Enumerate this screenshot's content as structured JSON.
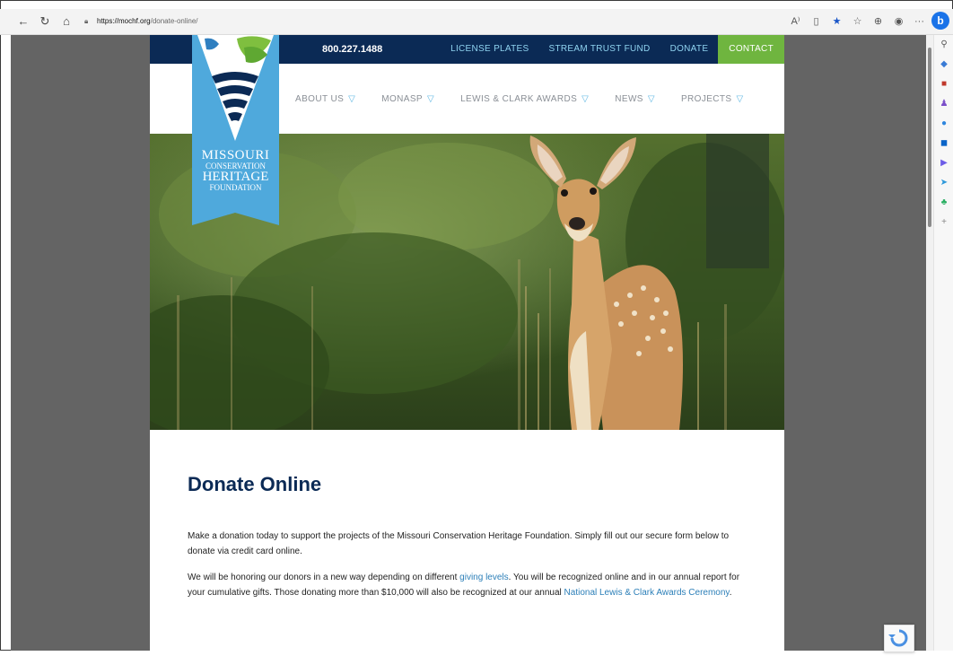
{
  "browser": {
    "url_host": "https://mochf.org",
    "url_path": "/donate-online/",
    "nav_icons": [
      "back-arrow",
      "refresh",
      "home"
    ],
    "toolbar_icons": [
      "read-aloud",
      "immersive-reader",
      "favorite-star",
      "favorites",
      "collections",
      "profile",
      "more"
    ]
  },
  "sidebar_icons": [
    "search",
    "shopping-tag",
    "tools-briefcase",
    "games",
    "office",
    "outlook",
    "drop",
    "send",
    "tree",
    "add"
  ],
  "site": {
    "colors": {
      "navy": "#0b2a55",
      "accent_blue": "#5fb7e3",
      "green": "#6fb53f",
      "link": "#2c7fb8"
    },
    "topbar": {
      "phone": "800.227.1488",
      "links": [
        "LICENSE PLATES",
        "STREAM TRUST FUND",
        "DONATE"
      ],
      "contact": "CONTACT"
    },
    "nav": [
      "ABOUT US",
      "MONASP",
      "LEWIS & CLARK AWARDS",
      "NEWS",
      "PROJECTS"
    ],
    "logo": {
      "line1": "MISSOURI",
      "line2": "CONSERVATION",
      "line3": "HERITAGE",
      "line4": "FOUNDATION"
    },
    "hero_image": "white-tailed-fawn-in-brush",
    "page": {
      "title": "Donate Online",
      "p1": "Make a donation today to support the projects of the Missouri Conservation Heritage Foundation. Simply fill out our secure form below to donate via credit card online.",
      "p2_a": "We will be honoring our donors in a new way depending on different ",
      "p2_link1": "giving levels",
      "p2_b": ". You will be recognized online and in our annual report for your cumulative gifts. Those donating more than $10,000 will also be recognized at our annual ",
      "p2_link2": "National Lewis & Clark Awards Ceremony",
      "p2_c": "."
    }
  }
}
